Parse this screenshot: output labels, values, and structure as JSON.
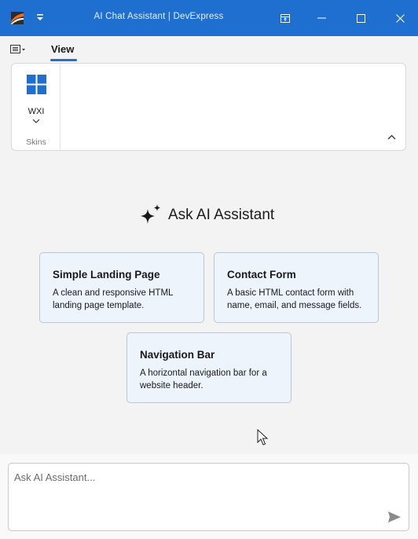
{
  "window": {
    "title": "AI Chat Assistant | DevExpress",
    "title_color": "#1f6fd1"
  },
  "ribbon": {
    "tabs": [
      {
        "label": "View",
        "selected": true
      }
    ],
    "groups": [
      {
        "label": "Skins",
        "items": [
          {
            "label": "WXI",
            "icon": "windows-icon"
          }
        ]
      }
    ]
  },
  "main": {
    "heading": "Ask AI Assistant",
    "heading_icon": "sparkle-icon",
    "suggestions": [
      {
        "title": "Simple Landing Page",
        "description": "A clean and responsive HTML landing page template."
      },
      {
        "title": "Contact Form",
        "description": "A basic HTML contact form with name, email, and message fields."
      },
      {
        "title": "Navigation Bar",
        "description": "A horizontal navigation bar for a website header."
      }
    ]
  },
  "prompt": {
    "placeholder": "Ask AI Assistant...",
    "value": "",
    "send_icon": "send-icon"
  },
  "colors": {
    "accent": "#1f6fd1",
    "card_background": "#eef4fc",
    "card_border": "#b9c6d6"
  }
}
